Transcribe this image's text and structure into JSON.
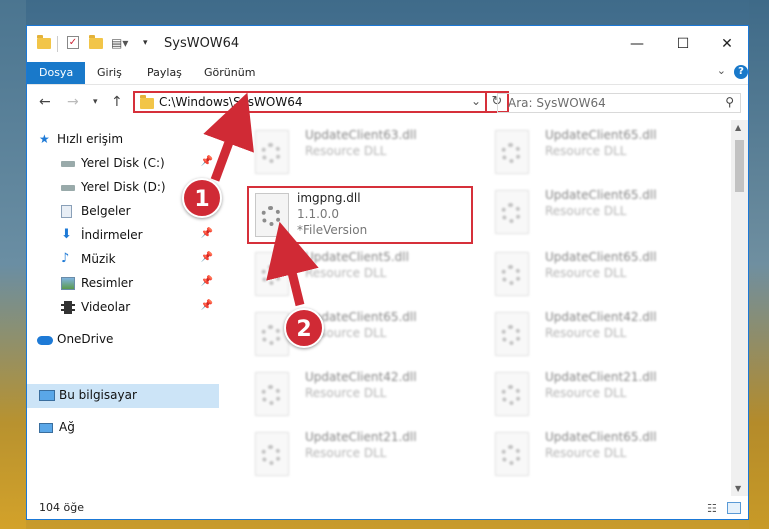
{
  "window": {
    "title": "SysWOW64",
    "controls": {
      "minimize": "—",
      "maximize": "☐",
      "close": "✕"
    }
  },
  "ribbon": {
    "tabs": [
      "Dosya",
      "Giriş",
      "Paylaş",
      "Görünüm"
    ],
    "help": "?"
  },
  "address": {
    "path": "C:\\Windows\\SysWOW64",
    "search_placeholder": "Ara: SysWOW64"
  },
  "sidebar": {
    "items": [
      {
        "label": "Hızlı erişim",
        "icon": "star-icon"
      },
      {
        "label": "Yerel Disk (C:)",
        "icon": "drive-icon"
      },
      {
        "label": "Yerel Disk (D:)",
        "icon": "drive-icon"
      },
      {
        "label": "Belgeler",
        "icon": "documents-icon"
      },
      {
        "label": "İndirmeler",
        "icon": "download-icon"
      },
      {
        "label": "Müzik",
        "icon": "music-icon"
      },
      {
        "label": "Resimler",
        "icon": "pictures-icon"
      },
      {
        "label": "Videolar",
        "icon": "video-icon"
      },
      {
        "label": "OneDrive",
        "icon": "cloud-icon"
      },
      {
        "label": "Bu bilgisayar",
        "icon": "computer-icon"
      },
      {
        "label": "Ağ",
        "icon": "network-icon"
      }
    ]
  },
  "files": {
    "highlighted": {
      "name": "imgpng.dll",
      "version": "1.1.0.0",
      "description": "*FileVersion"
    },
    "left_column": [
      {
        "name": "UpdateClient63.dll",
        "type": "Resource DLL"
      },
      {
        "name": "UpdateClient5.dll",
        "type": "Resource DLL"
      },
      {
        "name": "UpdateClient65.dll",
        "type": "Resource DLL"
      },
      {
        "name": "UpdateClient42.dll",
        "type": "Resource DLL"
      },
      {
        "name": "UpdateClient21.dll",
        "type": "Resource DLL"
      }
    ],
    "right_column": [
      {
        "name": "UpdateClient65.dll",
        "type": "Resource DLL"
      },
      {
        "name": "UpdateClient65.dll",
        "type": "Resource DLL"
      },
      {
        "name": "UpdateClient65.dll",
        "type": "Resource DLL"
      },
      {
        "name": "UpdateClient42.dll",
        "type": "Resource DLL"
      },
      {
        "name": "UpdateClient21.dll",
        "type": "Resource DLL"
      },
      {
        "name": "UpdateClient65.dll",
        "type": "Resource DLL"
      }
    ]
  },
  "status": {
    "item_count": "104 öğe"
  },
  "annotations": {
    "step1": "1",
    "step2": "2",
    "color": "#d02a35"
  }
}
